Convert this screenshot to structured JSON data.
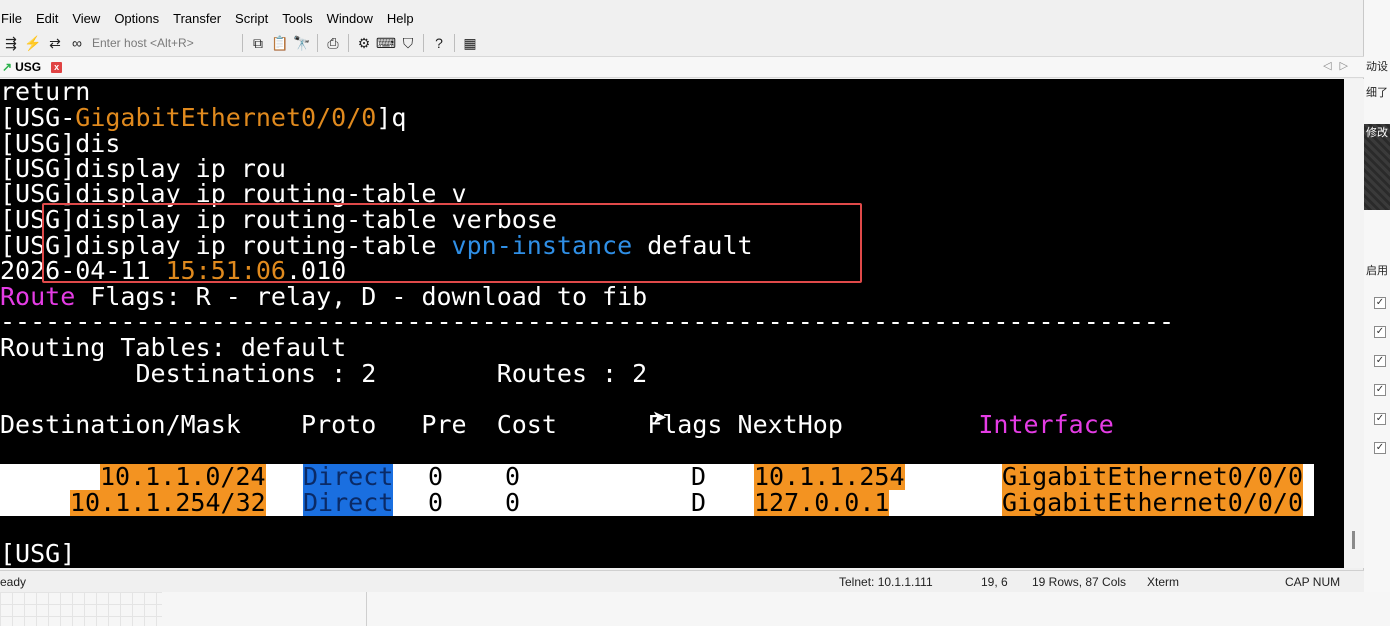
{
  "menu": [
    "File",
    "Edit",
    "View",
    "Options",
    "Transfer",
    "Script",
    "Tools",
    "Window",
    "Help"
  ],
  "toolbar": {
    "host_placeholder": "Enter host <Alt+R>",
    "help_label": "?"
  },
  "tab": {
    "title": "USG",
    "close": "x"
  },
  "terminal": {
    "lines": {
      "l1": "return",
      "l2a": "[USG-",
      "l2b": "GigabitEthernet0/0/0",
      "l2c": "]q",
      "l3": "[USG]dis",
      "l4": "[USG]display ip rou",
      "l5": "[USG]display ip routing-table v",
      "l6": "[USG]display ip routing-table verbose",
      "l7a": "[USG]display ip routing-table ",
      "l7b": "vpn-instance",
      "l7c": " default",
      "l8a": "2026-04-11 ",
      "l8b": "15:51:06",
      "l8c": ".010",
      "l9a": "Route",
      "l9b": " Flags: R - relay, D - download to fib",
      "l10": "------------------------------------------------------------------------------",
      "l11": "Routing Tables: default",
      "l12": "         Destinations : 2        Routes : 2",
      "l13a": "Destination/Mask    Proto   Pre  Cost      Flags NextHop         ",
      "l13b": "Interface",
      "prompt": "[USG]"
    },
    "routes": [
      {
        "dest": "10.1.1.0/24",
        "proto": "Direct",
        "pre": "0",
        "cost": "0",
        "flags": "D",
        "nexthop": "10.1.1.254",
        "iface": "GigabitEthernet0/0/0"
      },
      {
        "dest": "10.1.1.254/32",
        "proto": "Direct",
        "pre": "0",
        "cost": "0",
        "flags": "D",
        "nexthop": "127.0.0.1",
        "iface": "GigabitEthernet0/0/0"
      }
    ]
  },
  "status": {
    "ready": "eady",
    "telnet": "Telnet: 10.1.1.111",
    "cursor": "19,  6",
    "size": "19 Rows, 87 Cols",
    "emulation": "Xterm",
    "keys": "CAP NUM"
  },
  "side": {
    "t1": "动设",
    "t2": "细了",
    "t3": "修改",
    "t4": "启用",
    "check": "✓"
  },
  "colors": {
    "orange": "#f39321",
    "blue": "#1a6fe0",
    "magenta": "#e53ce5",
    "highlight_box": "#e04a4a"
  }
}
